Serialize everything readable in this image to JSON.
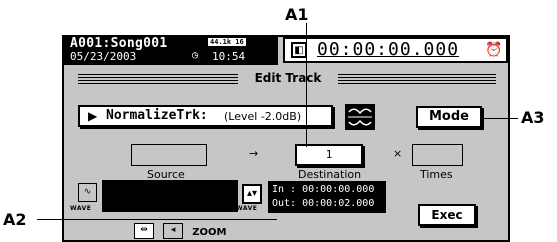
{
  "header": {
    "song": "A001:Song001",
    "date": "05/23/2003",
    "sample_rate": "44.1k 16",
    "time": "10:54",
    "clock_icon": "clock-icon"
  },
  "locator": {
    "time": "00:00:00.000",
    "icon": "locate-icon",
    "alarm_icon": "alarm-clock-icon"
  },
  "page": {
    "title": "Edit Track"
  },
  "function": {
    "arrow": "▶",
    "name": "NormalizeTrk:",
    "param": "(Level -2.0dB)"
  },
  "mode_button": "Mode",
  "source": {
    "label": "Source",
    "value": ""
  },
  "arrow_sep": "→",
  "destination": {
    "label": "Destination",
    "value": "1"
  },
  "times_sep": "×",
  "times": {
    "label": "Times",
    "value": ""
  },
  "wave_label_left": "WAVE",
  "wave_label_right": "WAVE",
  "inout": {
    "in": "In : 00:00:00.000",
    "out": "Out: 00:00:02.000"
  },
  "exec_button": "Exec",
  "zoom_label": "ZOOM",
  "callouts": {
    "a1": "A1",
    "a2": "A2",
    "a3": "A3"
  }
}
